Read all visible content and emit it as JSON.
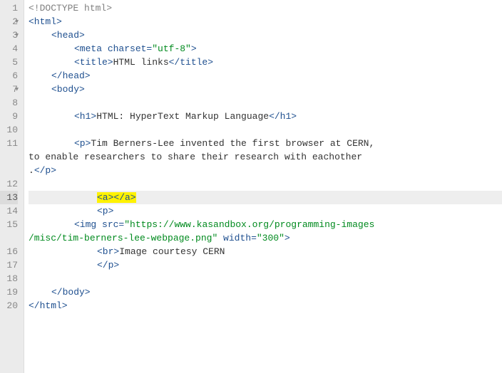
{
  "gutter": {
    "lines": [
      "1",
      "2",
      "3",
      "4",
      "5",
      "6",
      "7",
      "8",
      "9",
      "10",
      "11",
      "",
      "",
      "12",
      "13",
      "14",
      "15",
      "",
      "16",
      "17",
      "18",
      "19",
      "20"
    ],
    "foldable": [
      false,
      true,
      true,
      false,
      false,
      false,
      true,
      false,
      false,
      false,
      false,
      false,
      false,
      false,
      false,
      false,
      false,
      false,
      false,
      false,
      false,
      false,
      false
    ]
  },
  "tokens": {
    "doctype": "<!DOCTYPE html>",
    "html_open": "<html>",
    "html_close": "</html>",
    "head_open": "<head>",
    "head_close": "</head>",
    "meta_open": "<meta ",
    "charset_attr": "charset",
    "equals": "=",
    "charset_val": "\"utf-8\"",
    "meta_close": ">",
    "title_open": "<title>",
    "title_text": "HTML links",
    "title_close": "</title>",
    "body_open": "<body>",
    "body_close": "</body>",
    "h1_open": "<h1>",
    "h1_text": "HTML: HyperText Markup Language",
    "h1_close": "</h1>",
    "p_open": "<p>",
    "p_close": "</p>",
    "para1_a": "Tim Berners-Lee invented the first browser at CERN, ",
    "para1_b": "to enable researchers to share their research with eachother",
    "para1_c": ".",
    "a_open": "<a>",
    "a_close": "</a>",
    "img_open": "<img ",
    "src_attr": "src",
    "src_val_a": "\"https://www.kasandbox.org/programming-images",
    "src_val_b": "/misc/tim-berners-lee-webpage.png\"",
    "width_attr": " width",
    "width_val": "\"300\"",
    "img_close": ">",
    "br": "<br>",
    "img_caption": "Image courtesy CERN"
  },
  "highlight_line": 13
}
